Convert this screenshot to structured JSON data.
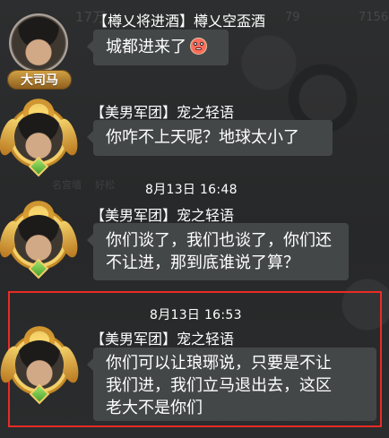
{
  "background_text": {
    "top_left": "17万",
    "top_mid": "79",
    "top_right": "7156",
    "mid_1": "名宫墙",
    "mid_2": "好松"
  },
  "messages": [
    {
      "sender": "【樽乂将进酒】樽乂空盃酒",
      "avatar_badge": "大司马",
      "lines": [
        "城都进来了"
      ],
      "emoji": "angry-face"
    },
    {
      "sender": "【美男军团】宠之轻语",
      "lines": [
        "你咋不上天呢？地球太小了"
      ]
    },
    {
      "timestamp": "8月13日  16:48",
      "sender": "【美男军团】宠之轻语",
      "lines": [
        "你们谈了，我们也谈了，你们还",
        "不让进，那到底谁说了算？"
      ]
    },
    {
      "timestamp": "8月13日  16:53",
      "sender": "【美男军团】宠之轻语",
      "lines": [
        "你们可以让琅琊说，只要是不让",
        "我们进，我们立马退出去，这区",
        "老大不是你们"
      ]
    }
  ],
  "colors": {
    "background": "#2a2b2c",
    "bubble": "#444748",
    "highlight": "#ea2b27",
    "text": "#ffffff",
    "badge": "#d4a447"
  }
}
